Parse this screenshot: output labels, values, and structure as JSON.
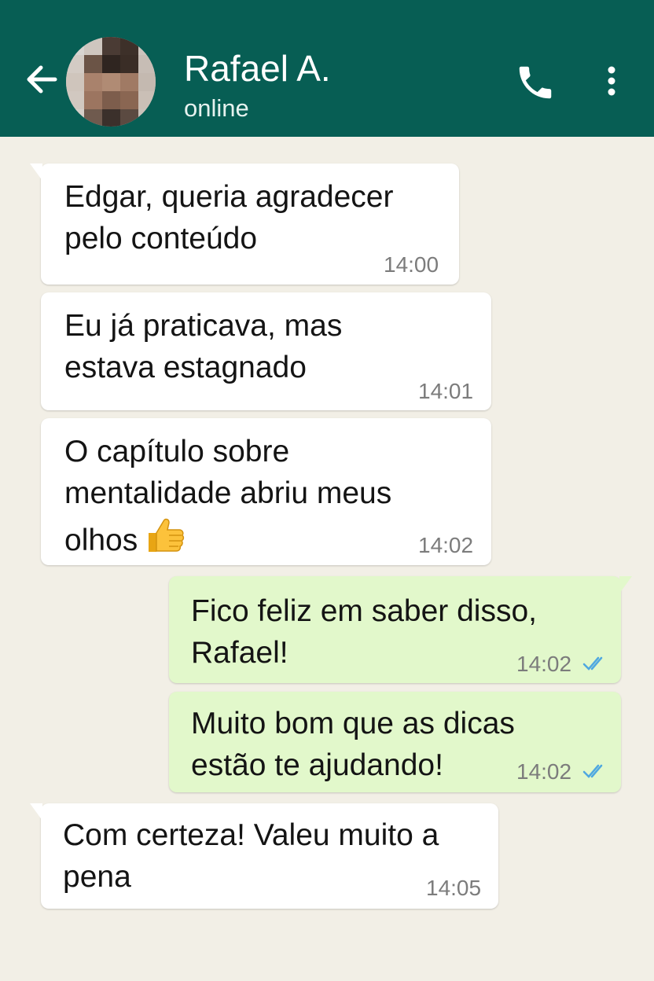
{
  "header": {
    "contact_name": "Rafael A.",
    "status": "online",
    "bg_color": "#075e54"
  },
  "icons": {
    "back": "arrow-left",
    "call": "phone",
    "menu": "more-vertical",
    "read_receipt": "double-check"
  },
  "colors": {
    "incoming_bubble": "#ffffff",
    "outgoing_bubble": "#e2f8cb",
    "read_ticks": "#4fa8e0",
    "chat_background": "#f2efe6"
  },
  "messages": [
    {
      "direction": "incoming",
      "lines": [
        "Edgar, queria agradecer",
        "pelo conteúdo"
      ],
      "time": "14:00"
    },
    {
      "direction": "incoming",
      "lines": [
        "Eu já praticava, mas",
        "estava estagnado"
      ],
      "time": "14:01"
    },
    {
      "direction": "incoming",
      "lines": [
        "O capítulo sobre",
        "mentalidade abriu meus",
        "olhos"
      ],
      "emoji": "thumbs-up",
      "time": "14:02"
    },
    {
      "direction": "outgoing",
      "lines": [
        "Fico feliz em saber disso,",
        "Rafael!"
      ],
      "time": "14:02",
      "status": "read"
    },
    {
      "direction": "outgoing",
      "lines": [
        "Muito bom que as dicas",
        "estão te ajudando!"
      ],
      "time": "14:02",
      "status": "read"
    },
    {
      "direction": "incoming",
      "lines": [
        "Com certeza! Valeu muito a",
        "pena"
      ],
      "time": "14:05"
    }
  ]
}
